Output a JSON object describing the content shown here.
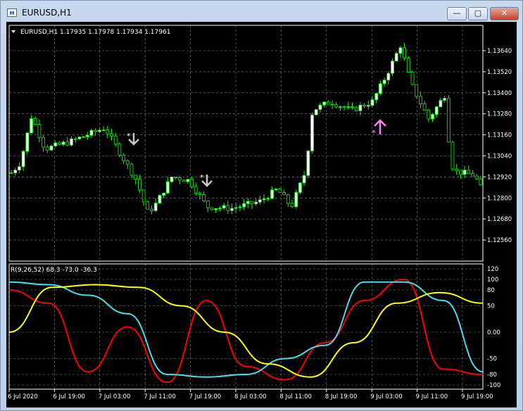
{
  "window": {
    "title": "EURUSD,H1",
    "icon": "chart-window-icon",
    "controls": {
      "minimize": "—",
      "maximize": "▢",
      "close": "✕"
    }
  },
  "chart": {
    "header": "EURUSD,H1  1.17935 1.17978 1.17934 1.17961",
    "symbol": "EURUSD",
    "timeframe": "H1",
    "price_labels": [
      "1.13640",
      "1.13520",
      "1.13400",
      "1.13280",
      "1.13160",
      "1.13040",
      "1.12920",
      "1.12800",
      "1.12680",
      "1.12560"
    ],
    "time_labels": [
      "6 Jul 2020",
      "6 Jul 19:00",
      "7 Jul 03:00",
      "7 Jul 11:00",
      "7 Jul 19:00",
      "8 Jul 03:00",
      "8 Jul 11:00",
      "8 Jul 19:00",
      "9 Jul 03:00",
      "9 Jul 11:00",
      "9 Jul 19:00"
    ],
    "colors": {
      "background": "#000000",
      "grid": "#c0c0c0",
      "candle": "#00ff00",
      "arrow_down": "#c8c8c8",
      "arrow_up": "#ff80ff",
      "bull_body": "#ffffff",
      "bear_body": "#000000"
    }
  },
  "indicator": {
    "header": "R(9,26,52) 68.3 -73.0 -36.3",
    "levels": [
      "120",
      "100",
      "80",
      "50",
      "0.00",
      "-50",
      "-80",
      "-100"
    ],
    "colors": {
      "red": "#ff0000",
      "cyan": "#40e0f0",
      "yellow": "#ffff00"
    }
  },
  "chart_data": {
    "type": "line",
    "title": "R(9,26,52) 68.3 -73.0 -36.3",
    "x": [
      "6 Jul 2020",
      "6 Jul 19:00",
      "7 Jul 03:00",
      "7 Jul 11:00",
      "7 Jul 19:00",
      "8 Jul 03:00",
      "8 Jul 11:00",
      "8 Jul 19:00",
      "9 Jul 03:00",
      "9 Jul 11:00",
      "9 Jul 19:00"
    ],
    "ylim": [
      -100,
      120
    ],
    "series": [
      {
        "color": "#ff0000",
        "values": [
          80,
          55,
          -75,
          10,
          -95,
          60,
          -65,
          -90,
          -20,
          60,
          100,
          -70,
          -80
        ]
      },
      {
        "color": "#40e0f0",
        "values": [
          95,
          90,
          70,
          35,
          -80,
          -85,
          -80,
          -50,
          -25,
          95,
          95,
          60,
          -75
        ]
      },
      {
        "color": "#ffff00",
        "values": [
          0,
          85,
          90,
          85,
          50,
          0,
          -60,
          -85,
          -20,
          55,
          75,
          55
        ]
      }
    ]
  }
}
